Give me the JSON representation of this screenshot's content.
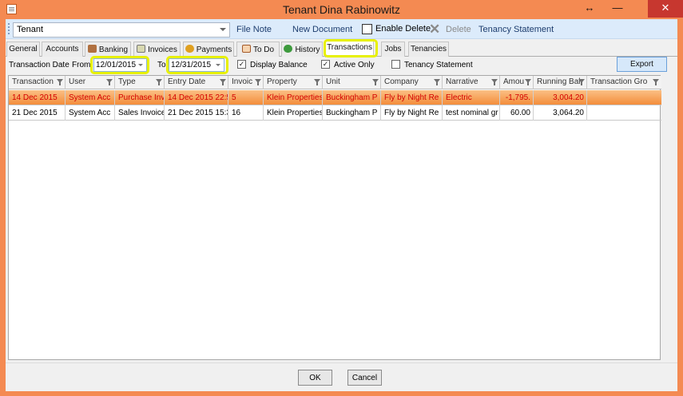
{
  "window": {
    "title": "Tenant Dina Rabinowitz",
    "controls": {
      "resize": "↔",
      "minimize": "—",
      "close": "✕"
    }
  },
  "toolbar": {
    "tenant_select_value": "Tenant",
    "file_note": "File Note",
    "new_document": "New Document",
    "enable_delete": "Enable Delete",
    "delete": "Delete",
    "tenancy_statement": "Tenancy Statement"
  },
  "tabs": [
    {
      "label": "General",
      "icon": ""
    },
    {
      "label": "Accounts",
      "icon": ""
    },
    {
      "label": "Banking",
      "icon": "banking-icon"
    },
    {
      "label": "Invoices",
      "icon": "invoices-icon"
    },
    {
      "label": "Payments",
      "icon": "payments-icon"
    },
    {
      "label": "To Do",
      "icon": "todo-icon"
    },
    {
      "label": "History",
      "icon": "history-icon"
    },
    {
      "label": "Transactions",
      "icon": ""
    },
    {
      "label": "Jobs",
      "icon": ""
    },
    {
      "label": "Tenancies",
      "icon": ""
    }
  ],
  "active_tab": "Transactions",
  "filters": {
    "transaction_date_label": "Transaction Date",
    "from_label": "From",
    "from_value": "12/01/2015",
    "to_label": "To",
    "to_value": "12/31/2015",
    "display_balance_label": "Display Balance",
    "display_balance_checked": true,
    "active_only_label": "Active Only",
    "active_only_checked": true,
    "tenancy_statement_label": "Tenancy Statement",
    "tenancy_statement_checked": false,
    "export_label": "Export"
  },
  "grid": {
    "columns": [
      "Transaction",
      "User",
      "Type",
      "Entry Date",
      "Invoic",
      "Property",
      "Unit",
      "Company",
      "Narrative",
      "Amou",
      "Running Bal",
      "Transaction Gro"
    ],
    "rows": [
      [
        "14 Dec 2015",
        "System Acc",
        "Purchase Inv",
        "14 Dec 2015 22:5",
        "5",
        "Klein Properties",
        "Buckingham P",
        "Fly by Night Re",
        "Electric",
        "-1,795.",
        "3,004.20",
        ""
      ],
      [
        "21 Dec 2015",
        "System Acc",
        "Sales Invoice",
        "21 Dec 2015 15:3",
        "16",
        "Klein Properties",
        "Buckingham P",
        "Fly by Night Re",
        "test nominal gr",
        "60.00",
        "3,064.20",
        ""
      ]
    ],
    "selected_row": 0
  },
  "footer": {
    "ok": "OK",
    "cancel": "Cancel"
  },
  "colors": {
    "titlebar": "#f48a52",
    "selected_row": "#f38d3c",
    "highlight": "#e7f000",
    "close_button": "#c7372f"
  }
}
